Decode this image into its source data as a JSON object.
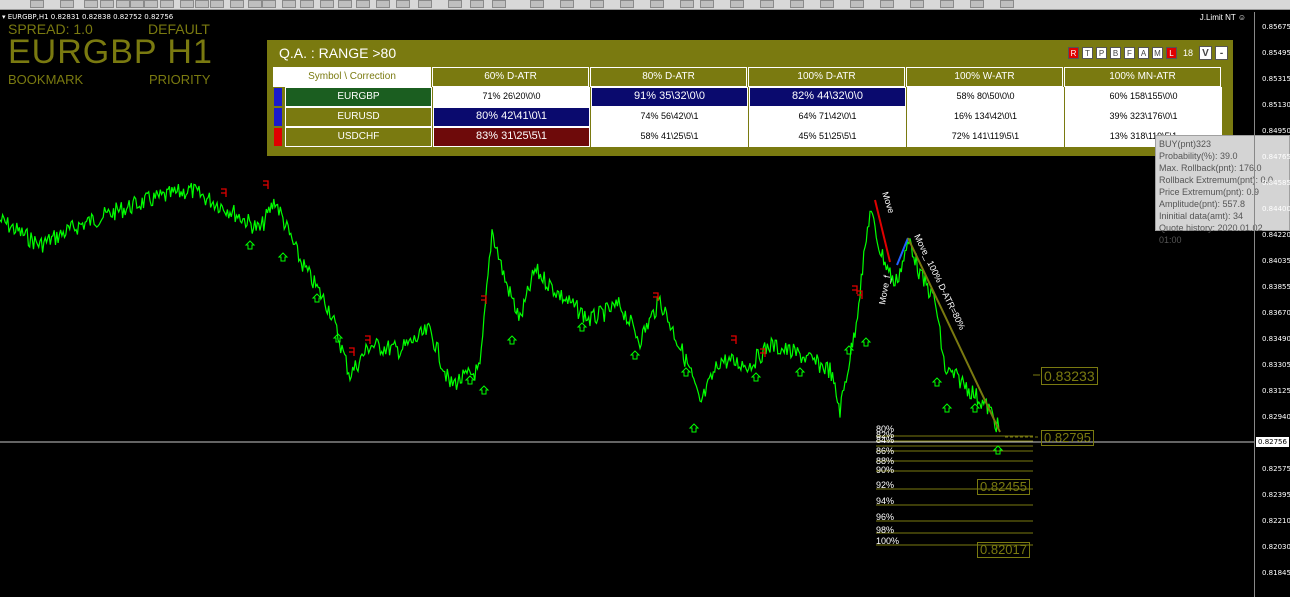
{
  "header": {
    "symbol_line": "EURGBP,H1  0.82831 0.82838 0.82752 0.82756",
    "spread": "SPREAD: 1.0",
    "profile": "DEFAULT",
    "title": "EURGBP H1",
    "bookmark": "BOOKMARK",
    "priority": "PRIORITY",
    "indicator_label": "J.Limit NT ☺"
  },
  "panel": {
    "title": "Q.A. : RANGE   >80",
    "buttons": [
      "R",
      "T",
      "P",
      "B",
      "F",
      "A",
      "M",
      "L"
    ],
    "count": "18",
    "v_label": "V",
    "minus_label": "-",
    "headers": [
      "Symbol \\ Correction",
      "60% D-ATR",
      "80% D-ATR",
      "100% D-ATR",
      "100% W-ATR",
      "100% MN-ATR"
    ],
    "rows": [
      {
        "symbol": "EURGBP",
        "marker": "#1a1acc",
        "symbol_bg": "#1b5e20",
        "values": [
          "71% 26\\20\\0\\0",
          "91% 35\\32\\0\\0",
          "82% 44\\32\\0\\0",
          "58% 80\\50\\0\\0",
          "60% 158\\155\\0\\0"
        ],
        "highlight": [
          null,
          "#0a0a6e",
          "#0a0a6e",
          null,
          null
        ]
      },
      {
        "symbol": "EURUSD",
        "marker": "#1a1acc",
        "symbol_bg": "#7a7a10",
        "values": [
          "80% 42\\41\\0\\1",
          "74% 56\\42\\0\\1",
          "64% 71\\42\\0\\1",
          "16% 134\\42\\0\\1",
          "39% 323\\176\\0\\1"
        ],
        "highlight": [
          "#0a0a6e",
          null,
          null,
          null,
          null
        ]
      },
      {
        "symbol": "USDCHF",
        "marker": "#e00000",
        "symbol_bg": "#7a7a10",
        "values": [
          "83% 31\\25\\5\\1",
          "58% 41\\25\\5\\1",
          "45% 51\\25\\5\\1",
          "72% 141\\119\\5\\1",
          "13% 318\\119\\5\\1"
        ],
        "highlight": [
          "#6e0a0a",
          null,
          null,
          null,
          null
        ]
      }
    ]
  },
  "tooltip": {
    "lines": [
      "BUY(pnt)323",
      "Probability(%): 39.0",
      "Max. Rollback(pnt): 176.0",
      "Rollback Extremum(pnt): 0.0",
      "Price Extremum(pnt): 0.9",
      "Amplitude(pnt): 557.8",
      "Ininitial data(amt): 34",
      "Quote history: 2020.01.02 01:00"
    ]
  },
  "price_axis": {
    "labels": [
      "0.85675",
      "0.85495",
      "0.85315",
      "0.85130",
      "0.84950",
      "0.84765",
      "0.84585",
      "0.84400",
      "0.84220",
      "0.84035",
      "0.83855",
      "0.83670",
      "0.83490",
      "0.83305",
      "0.83125",
      "0.82940",
      "0.82575",
      "0.82395",
      "0.82210",
      "0.82030",
      "0.81845"
    ],
    "current": "0.82756"
  },
  "price_boxes": {
    "top": "0.83233",
    "near": "0.82795",
    "mid": "0.82455",
    "low": "0.82017"
  },
  "levels": [
    "80%",
    "82%",
    "84%",
    "86%",
    "88%",
    "90%",
    "92%",
    "94%",
    "96%",
    "98%",
    "100%"
  ],
  "annotations": {
    "move_top": "Move",
    "move_left": "Move_f",
    "move_long": "Move_ 100% D-ATR=80%"
  },
  "colors": {
    "price_line": "#00ff00",
    "accent": "#7a7a10",
    "down_marker": "#e00000",
    "up_marker": "#00ff00"
  }
}
